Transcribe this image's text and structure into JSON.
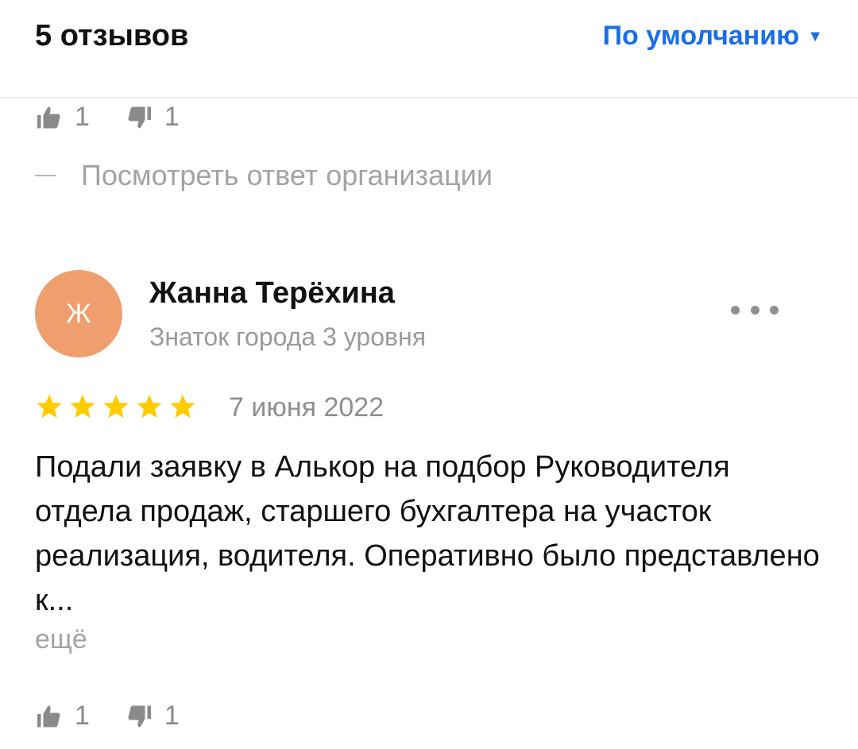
{
  "header": {
    "reviews_count": "5 отзывов",
    "sort_label": "По умолчанию",
    "sort_arrow": "▼"
  },
  "previous_review": {
    "likes": "1",
    "dislikes": "1",
    "org_reply_link": "Посмотреть ответ организации"
  },
  "review": {
    "avatar_letter": "Ж",
    "author_name": "Жанна Терёхина",
    "author_level": "Знаток города 3 уровня",
    "rating": 5,
    "date": "7 июня 2022",
    "text": "Подали заявку в Алькор на подбор Руководителя отдела продаж, старшего бухгалтера на участок реализация, водителя. Оперативно было представлено к...",
    "more_link": "ещё",
    "likes": "1",
    "dislikes": "1"
  },
  "colors": {
    "accent": "#1a6ee8",
    "avatar_bg": "#ef9f6e",
    "star": "#ffcc00",
    "muted": "#8a8a8a"
  },
  "icons": {
    "like": "thumbs-up-icon",
    "dislike": "thumbs-down-icon",
    "more": "more-dots-icon",
    "star": "star-icon"
  }
}
